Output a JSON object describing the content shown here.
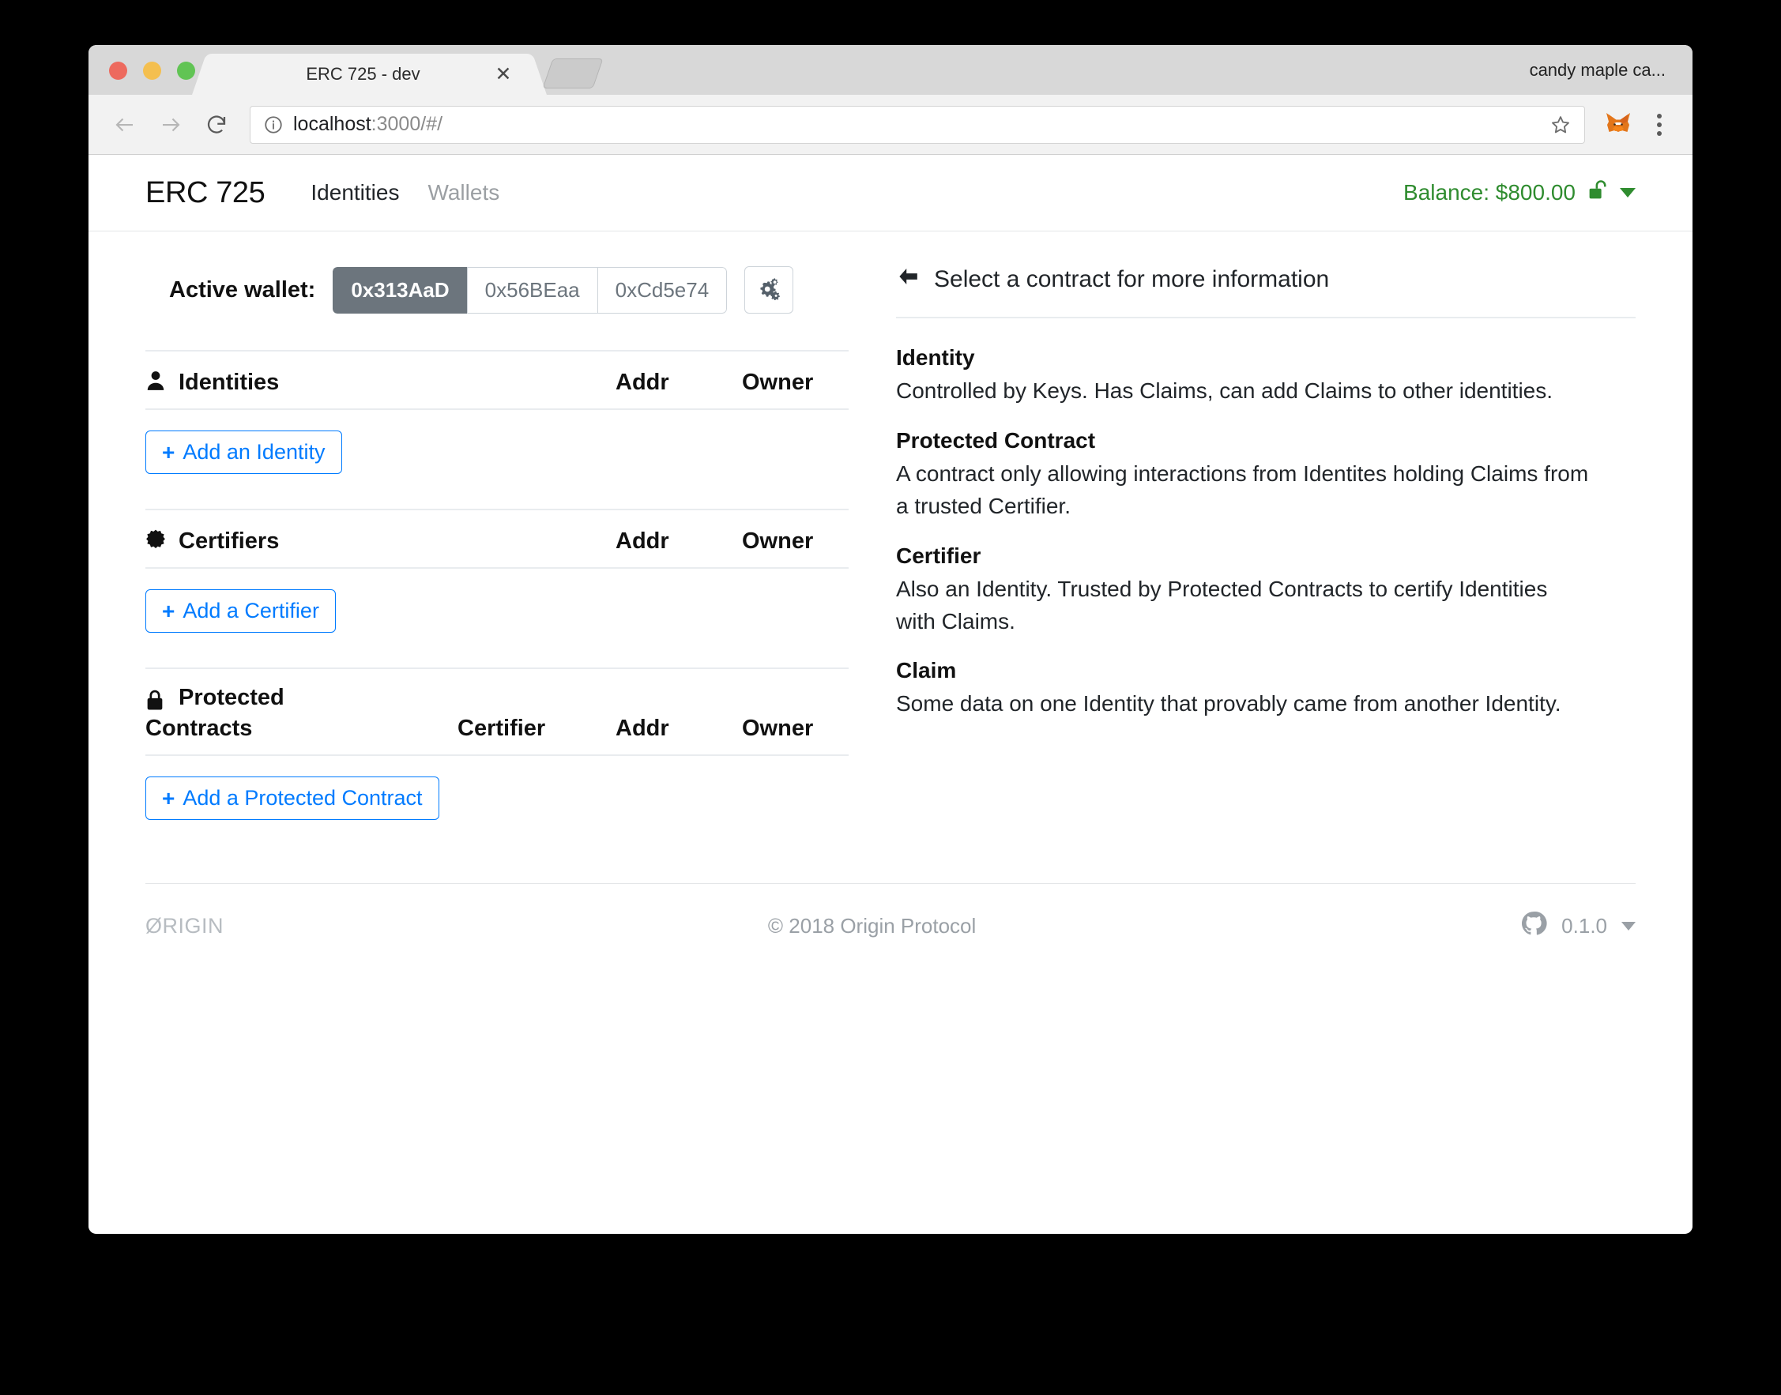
{
  "browser": {
    "tab_title": "ERC 725 - dev",
    "tab_close_label": "✕",
    "profile_name": "candy maple ca...",
    "url_main": "localhost",
    "url_dim": ":3000/#/",
    "icons": {
      "back": "back-arrow-icon",
      "forward": "forward-arrow-icon",
      "reload": "reload-icon",
      "info": "info-icon",
      "star": "star-icon",
      "extension": "metamask-fox-icon",
      "menu": "three-dot-menu-icon"
    }
  },
  "app": {
    "brand": "ERC 725",
    "nav_links": [
      {
        "label": "Identities",
        "active": true
      },
      {
        "label": "Wallets",
        "active": false
      }
    ],
    "balance": {
      "text": "Balance: $800.00",
      "color": "#2f8c2f",
      "lock_state": "unlocked"
    },
    "wallet": {
      "label": "Active wallet:",
      "options": [
        {
          "address": "0x313AaD",
          "active": true
        },
        {
          "address": "0x56BEaa",
          "active": false
        },
        {
          "address": "0xCd5e74",
          "active": false
        }
      ],
      "settings_icon": "cogs-icon"
    },
    "sections": [
      {
        "icon": "person-icon",
        "title": "Identities",
        "columns": [
          "Addr",
          "Owner"
        ],
        "add_label": "Add an Identity",
        "plus": "+"
      },
      {
        "icon": "certificate-icon",
        "title": "Certifiers",
        "columns": [
          "Addr",
          "Owner"
        ],
        "add_label": "Add a Certifier",
        "plus": "+"
      },
      {
        "icon": "lock-icon",
        "title_line1": "Protected",
        "title_line2": "Contracts",
        "columns": [
          "Certifier",
          "Addr",
          "Owner"
        ],
        "add_label": "Add a Protected Contract",
        "plus": "+"
      }
    ],
    "detail": {
      "header": "Select a contract for more information",
      "back_icon": "back-arrow-icon",
      "definitions": [
        {
          "term": "Identity",
          "desc": "Controlled by Keys. Has Claims, can add Claims to other identities."
        },
        {
          "term": "Protected Contract",
          "desc": "A contract only allowing interactions from Identites holding Claims from a trusted Certifier."
        },
        {
          "term": "Certifier",
          "desc": "Also an Identity. Trusted by Protected Contracts to certify Identities with Claims."
        },
        {
          "term": "Claim",
          "desc": "Some data on one Identity that provably came from another Identity."
        }
      ]
    },
    "footer": {
      "logo": "ØRIGIN",
      "copyright": "© 2018  Origin Protocol",
      "version": "0.1.0",
      "github_icon": "github-icon"
    }
  },
  "colors": {
    "accent_blue": "#007bff",
    "balance_green": "#2f8c2f",
    "active_wallet_bg": "#6c757d",
    "divider": "#e9ecef"
  }
}
